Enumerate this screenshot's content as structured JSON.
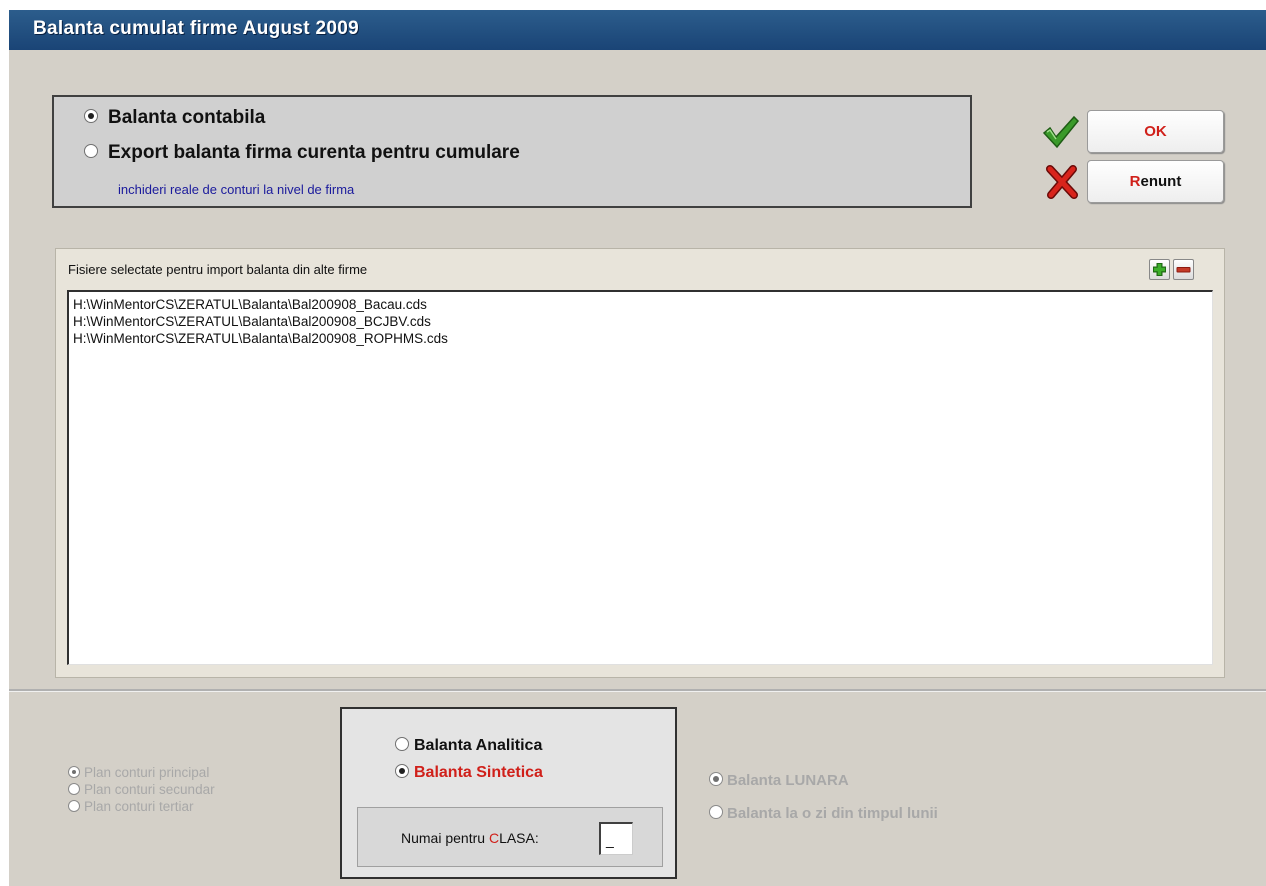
{
  "window": {
    "title": "Balanta cumulat firme August 2009"
  },
  "options": {
    "balanta_contabila": "Balanta contabila",
    "export_balanta": "Export balanta firma curenta pentru cumulare",
    "note": "inchideri reale de conturi la nivel de firma",
    "selected": "balanta_contabila"
  },
  "buttons": {
    "ok": "OK",
    "cancel_hotkey": "R",
    "cancel_rest": "enunt"
  },
  "files": {
    "label": "Fisiere selectate pentru import balanta din alte firme",
    "items": [
      "H:\\WinMentorCS\\ZERATUL\\Balanta\\Bal200908_Bacau.cds",
      "H:\\WinMentorCS\\ZERATUL\\Balanta\\Bal200908_BCJBV.cds",
      "H:\\WinMentorCS\\ZERATUL\\Balanta\\Bal200908_ROPHMS.cds"
    ]
  },
  "plan": {
    "principal": "Plan conturi principal",
    "secundar": "Plan conturi secundar",
    "tertiar": "Plan conturi tertiar",
    "selected": "principal"
  },
  "balanta_type": {
    "analitica": "Balanta Analitica",
    "sintetica": "Balanta Sintetica",
    "selected": "sintetica",
    "clasa_prefix": "Numai pentru ",
    "clasa_hotkey": "C",
    "clasa_rest": "LASA:",
    "clasa_value": "_"
  },
  "period": {
    "lunara": "Balanta LUNARA",
    "zi": "Balanta la o zi din timpul lunii",
    "selected": "lunara"
  },
  "colors": {
    "title_bar": "#1f4a7c",
    "accent_red": "#d0201a",
    "note_blue": "#1a1a9c"
  }
}
